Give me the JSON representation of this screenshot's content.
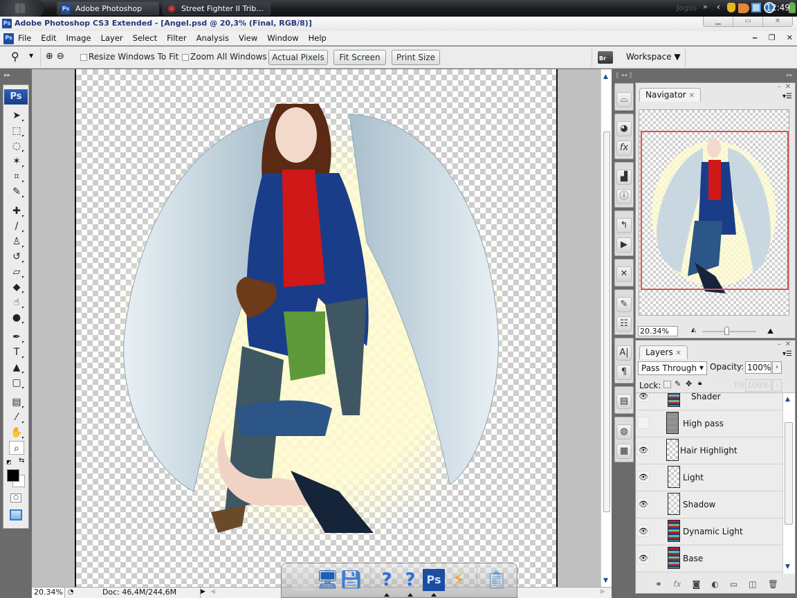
{
  "taskbar": {
    "tasks": [
      {
        "label": "Adobe Photoshop CS...",
        "icon": "photoshop-icon"
      },
      {
        "label": "Street Fighter II Trib...",
        "icon": "browser-icon"
      }
    ],
    "tray_label": "Jogos",
    "tray_icons": [
      "shield-warning-icon",
      "checkmark-badge-icon",
      "network-icon",
      "download-icon",
      "user-icon"
    ],
    "clock": "12:49"
  },
  "app": {
    "title": "Adobe Photoshop CS3 Extended - [Angel.psd @ 20,3% (Final, RGB/8)]",
    "icon_text": "Ps"
  },
  "menu": [
    "File",
    "Edit",
    "Image",
    "Layer",
    "Select",
    "Filter",
    "Analysis",
    "View",
    "Window",
    "Help"
  ],
  "options": {
    "resize_windows": "Resize Windows To Fit",
    "zoom_all": "Zoom All Windows",
    "actual_pixels": "Actual Pixels",
    "fit_screen": "Fit Screen",
    "print_size": "Print Size",
    "workspace": "Workspace ▼"
  },
  "toolbox": {
    "logo": "Ps",
    "tools": [
      {
        "name": "move-tool",
        "glyph": "➤"
      },
      {
        "name": "marquee-tool",
        "glyph": "⬚"
      },
      {
        "name": "lasso-tool",
        "glyph": "◌"
      },
      {
        "name": "magic-wand-tool",
        "glyph": "✶"
      },
      {
        "name": "crop-tool",
        "glyph": "⌗"
      },
      {
        "name": "slice-tool",
        "glyph": "✎"
      },
      {
        "name": "healing-brush-tool",
        "glyph": "✚"
      },
      {
        "name": "brush-tool",
        "glyph": "/"
      },
      {
        "name": "clone-stamp-tool",
        "glyph": "♙"
      },
      {
        "name": "history-brush-tool",
        "glyph": "↺"
      },
      {
        "name": "eraser-tool",
        "glyph": "▱"
      },
      {
        "name": "paint-bucket-tool",
        "glyph": "◆"
      },
      {
        "name": "smudge-tool",
        "glyph": "☝"
      },
      {
        "name": "dodge-tool",
        "glyph": "●"
      },
      {
        "name": "pen-tool",
        "glyph": "✒"
      },
      {
        "name": "type-tool",
        "glyph": "T"
      },
      {
        "name": "path-selection-tool",
        "glyph": "▲"
      },
      {
        "name": "shape-tool",
        "glyph": "▢"
      },
      {
        "name": "notes-tool",
        "glyph": "▤"
      },
      {
        "name": "eyedropper-tool",
        "glyph": "⁄"
      },
      {
        "name": "hand-tool",
        "glyph": "✋"
      },
      {
        "name": "zoom-tool",
        "glyph": "⌕"
      }
    ],
    "foreground_color": "#000000",
    "background_color": "#ffffff"
  },
  "status": {
    "zoom": "20.34%",
    "doc": "Doc: 46,4M/244,6M"
  },
  "navigator": {
    "tab": "Navigator",
    "zoom": "20.34%",
    "view_box_color": "#e05050"
  },
  "layers_panel": {
    "tab": "Layers",
    "blend_mode": "Pass Through",
    "opacity_label": "Opacity:",
    "opacity": "100%",
    "lock_label": "Lock:",
    "fill_label": "Fill:",
    "fill": "100%",
    "layers": [
      {
        "name": "Shader",
        "visible": true,
        "thumb": "image"
      },
      {
        "name": "High pass",
        "visible": false,
        "thumb": "gray"
      },
      {
        "name": "Hair Highlight",
        "visible": true,
        "thumb": "transparent"
      },
      {
        "name": "Light",
        "visible": true,
        "thumb": "transparent"
      },
      {
        "name": "Shadow",
        "visible": true,
        "thumb": "transparent"
      },
      {
        "name": "Dynamic Light",
        "visible": true,
        "thumb": "image"
      },
      {
        "name": "Base",
        "visible": true,
        "thumb": "image"
      }
    ],
    "footer_icons": [
      "link-layers-icon",
      "fx-icon",
      "mask-icon",
      "adjustment-icon",
      "group-icon",
      "new-layer-icon",
      "trash-icon"
    ]
  },
  "dock": {
    "icons": [
      "blank-icon",
      "computer-icon",
      "disk-icon",
      "help-icon",
      "help-icon",
      "photoshop-icon",
      "winamp-icon",
      "notepad-icon"
    ]
  }
}
